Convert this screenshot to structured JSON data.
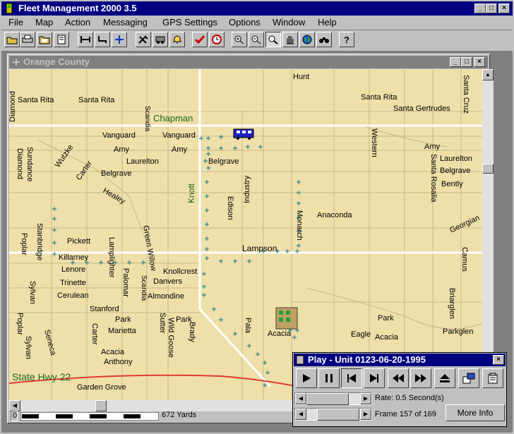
{
  "app": {
    "title": "Fleet Management 2000 3.5",
    "window_buttons": [
      "_",
      "□",
      "×"
    ]
  },
  "menu": [
    "File",
    "Map",
    "Action",
    "Messaging",
    "GPS Settings",
    "Options",
    "Window",
    "Help"
  ],
  "toolbar": {
    "icons": [
      "open-icon",
      "print-icon",
      "folder-icon",
      "document-icon",
      "route-icon",
      "route2-icon",
      "move-icon",
      "tools-icon",
      "vehicle-icon",
      "alarm-icon",
      "check-icon",
      "clock-icon",
      "zoom-in-icon",
      "zoom-out-icon",
      "magnifier-icon",
      "pan-hand-icon",
      "globe-icon",
      "binoculars-icon",
      "help-icon"
    ]
  },
  "map_window": {
    "title": "Orange County",
    "scale_value": "0",
    "scale_label": "672 Yards",
    "labels": {
      "santa_rita_1": "Santa Rita",
      "santa_rita_2": "Santa Rita",
      "santa_rita_3": "Santa Rita",
      "diamond": "Diamond",
      "scandia_1": "Scandia",
      "hunt": "Hunt",
      "santa_cruz": "Santa Cruz",
      "santa_gertrudes": "Santa Gertrudes",
      "chapman": "Chapman",
      "vanguard_1": "Vanguard",
      "vanguard_2": "Vanguard",
      "western": "Western",
      "amy_1": "Amy",
      "amy_2": "Amy",
      "amy_3": "Amy",
      "laurelton_1": "Laurelton",
      "laurelton_2": "Laurelton",
      "belgrave_1": "Belgrave",
      "belgrave_2": "Belgrave",
      "belgrave_3": "Belgrave",
      "diamond_2": "Diamond",
      "sundance": "Sundance",
      "wutzke": "Wutzke",
      "carter": "Carter",
      "healey": "Healey",
      "knott": "Knott",
      "industry": "Industry",
      "edison": "Edison",
      "santa_rosalia": "Santa Rosalia",
      "bently": "Bently",
      "anaconda": "Anaconda",
      "georgian": "Georgian",
      "monarch": "Monarch",
      "poplar_1": "Poplar",
      "stanbridge": "Stanbridge",
      "pickett": "Pickett",
      "lamplighter": "Lamplighter",
      "green_willow": "Green Willow",
      "lampson": "Lampson",
      "camus": "Camus",
      "killarney": "Killarney",
      "lenore": "Lenore",
      "knollcrest": "Knollcrest",
      "palomar": "Palomar",
      "danvers": "Danvers",
      "scandia_2": "Scandia",
      "sylvan_1": "Sylvan",
      "trinette": "Trinette",
      "almondine": "Almondine",
      "cerulean": "Cerulean",
      "briarglen": "Briarglen",
      "stanford": "Stanford",
      "poplar_2": "Poplar",
      "park_1": "Park",
      "park_2": "Park",
      "park_3": "Park",
      "marietta": "Marietta",
      "sutter": "Sutter",
      "wild_goose": "Wild Goose",
      "acacia_1": "Acacia",
      "acacia_2": "Acacia",
      "acacia_3": "Acacia",
      "pala": "Pala",
      "carter_2": "Carter",
      "eagle": "Eagle",
      "parkglen": "Parkglen",
      "sylvan_2": "Sylvan",
      "seneca": "Seneca",
      "brady": "Brady",
      "anthony": "Anthony",
      "state_hwy": "State Hwy 22",
      "garden_grove": "Garden Grove"
    }
  },
  "play_window": {
    "title": "Play - Unit 0123-06-20-1995",
    "controls": [
      "play-icon",
      "pause-icon",
      "go-to-start-icon",
      "go-to-end-icon",
      "rewind-icon",
      "fast-forward-icon",
      "eject-icon",
      "export-icon",
      "properties-icon"
    ],
    "rate_label": "Rate: 0.5 Second(s)",
    "frame_label": "Frame 157 of 169",
    "frame_current": 157,
    "frame_total": 169,
    "more_info": "More Info"
  },
  "colors": {
    "map_background": "#efdfa9",
    "road_major": "#ffffff",
    "road_minor": "#c8b88a",
    "highway": "#e03c30",
    "gps_point": "#2c8c8c",
    "title_active": "#000080",
    "title_inactive": "#808080"
  }
}
